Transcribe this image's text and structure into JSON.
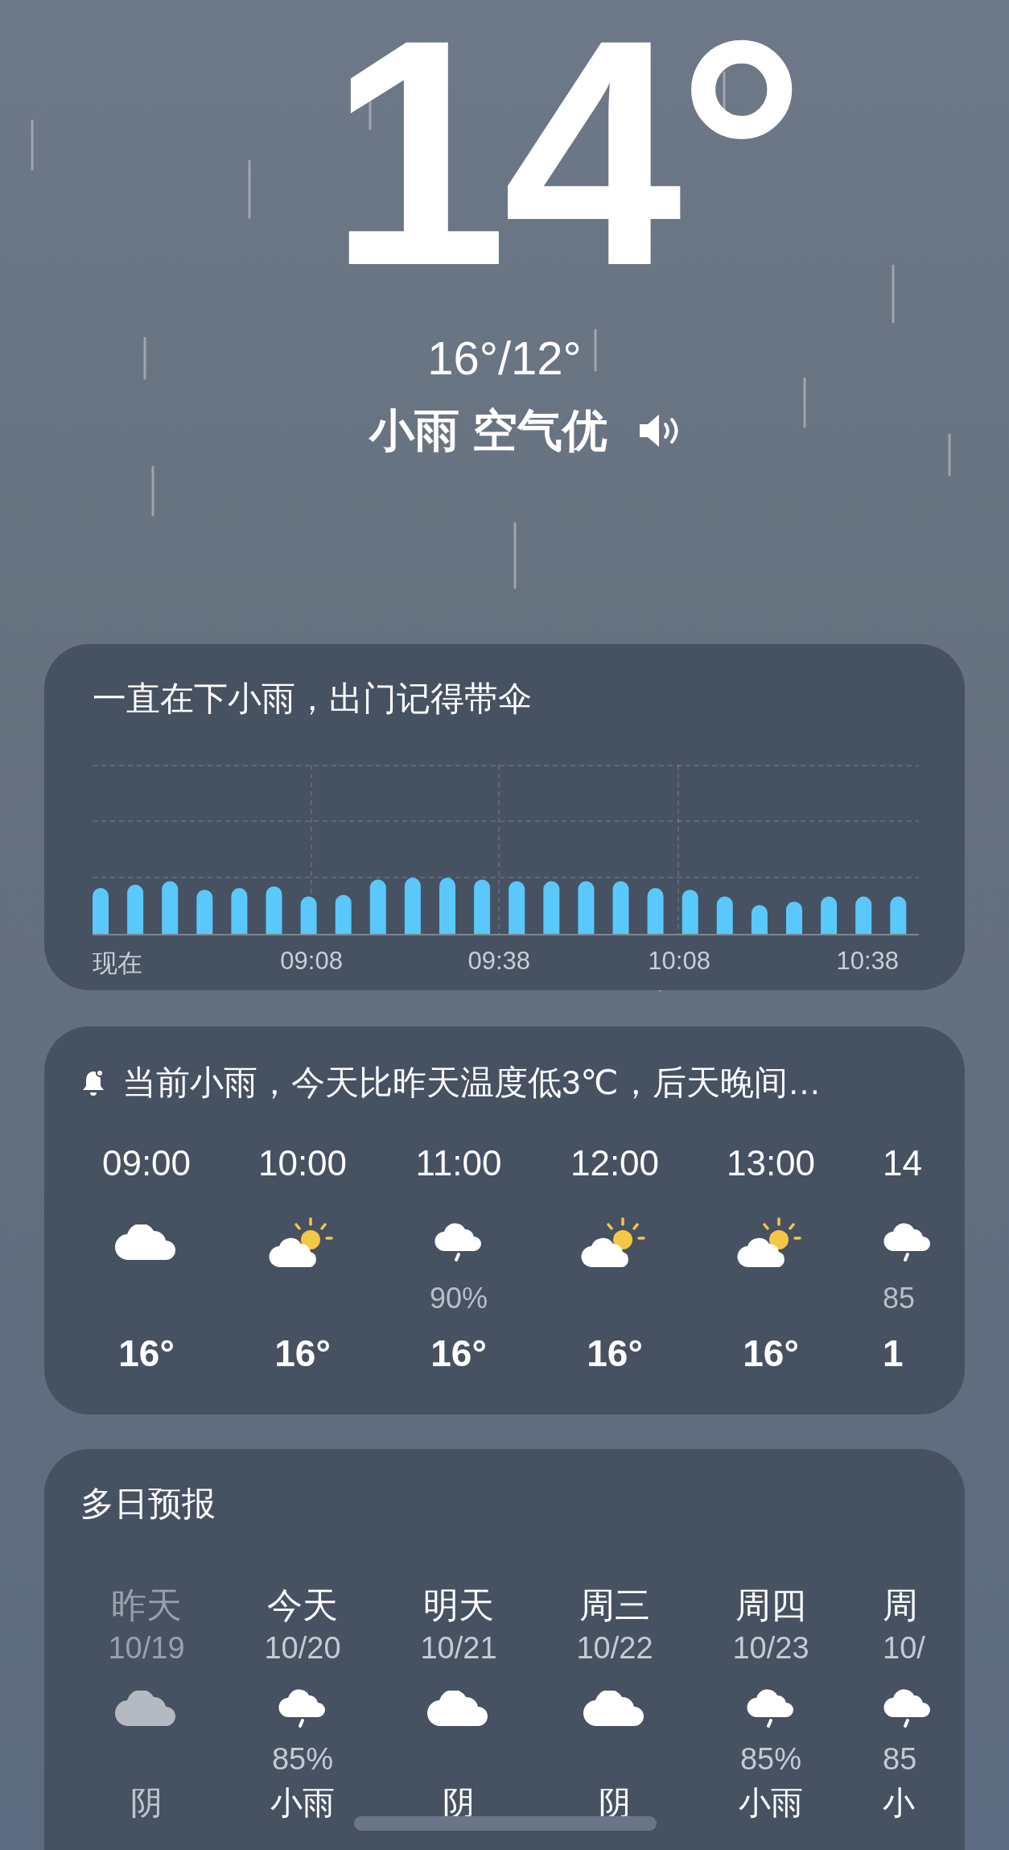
{
  "current": {
    "temperature": "14°",
    "high_low": "16°/12°",
    "condition": "小雨 空气优"
  },
  "rain_card": {
    "message": "一直在下小雨，出门记得带伞",
    "x_labels": [
      "现在",
      "09:08",
      "09:38",
      "10:08",
      "10:38"
    ]
  },
  "hourly_card": {
    "alert": "当前小雨，今天比昨天温度低3℃，后天晚间…",
    "hours": [
      {
        "time": "09:00",
        "kind": "cloudy",
        "temperature": "16°"
      },
      {
        "time": "10:00",
        "kind": "partly-sunny",
        "temperature": "16°"
      },
      {
        "time": "11:00",
        "kind": "rain",
        "precip": "90%",
        "temperature": "16°"
      },
      {
        "time": "12:00",
        "kind": "partly-sunny",
        "temperature": "16°"
      },
      {
        "time": "13:00",
        "kind": "partly-sunny",
        "temperature": "16°"
      },
      {
        "time": "14",
        "kind": "rain",
        "precip": "85",
        "temperature": "1"
      }
    ]
  },
  "daily_card": {
    "title": "多日预报",
    "days": [
      {
        "label": "昨天",
        "date": "10/19",
        "kind": "cloudy",
        "condition": "阴",
        "past": true
      },
      {
        "label": "今天",
        "date": "10/20",
        "kind": "rain",
        "precip": "85%",
        "condition": "小雨",
        "past": false
      },
      {
        "label": "明天",
        "date": "10/21",
        "kind": "cloudy",
        "condition": "阴",
        "past": false
      },
      {
        "label": "周三",
        "date": "10/22",
        "kind": "cloudy",
        "condition": "阴",
        "past": false
      },
      {
        "label": "周四",
        "date": "10/23",
        "kind": "rain",
        "precip": "85%",
        "condition": "小雨",
        "past": false
      },
      {
        "label": "周",
        "date": "10/",
        "kind": "rain",
        "precip": "85",
        "condition": "小",
        "past": false
      }
    ]
  }
}
